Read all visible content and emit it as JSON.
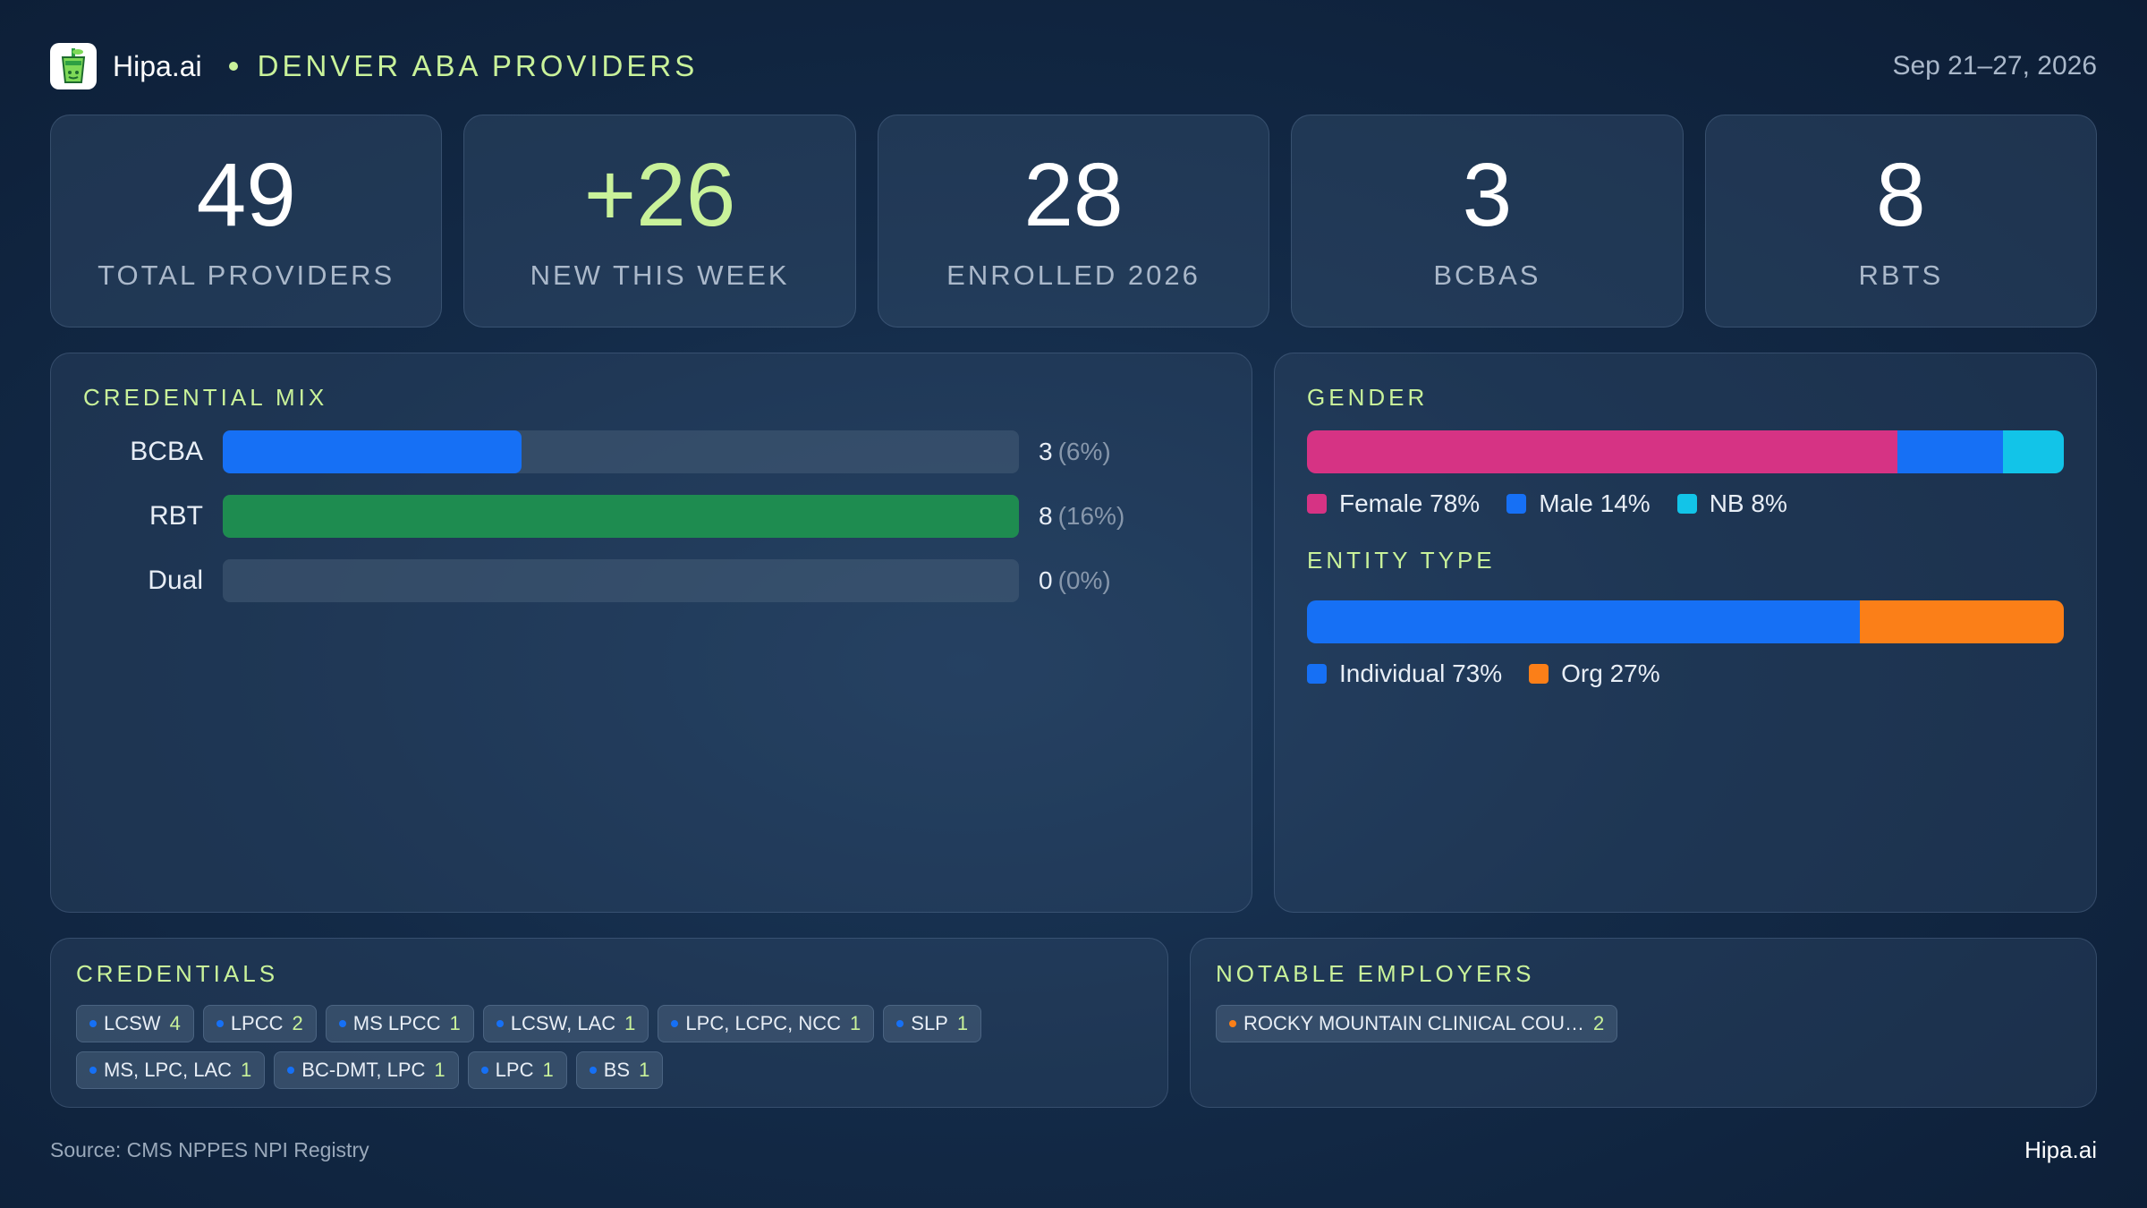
{
  "header": {
    "brand": "Hipa.ai",
    "title": "DENVER ABA PROVIDERS",
    "date_range": "Sep 21–27, 2026"
  },
  "kpis": [
    {
      "value": "49",
      "label": "TOTAL PROVIDERS"
    },
    {
      "value": "+26",
      "label": "NEW THIS WEEK"
    },
    {
      "value": "28",
      "label": "ENROLLED 2026"
    },
    {
      "value": "3",
      "label": "BCBAS"
    },
    {
      "value": "8",
      "label": "RBTS"
    }
  ],
  "credential_mix": {
    "title": "CREDENTIAL MIX"
  },
  "gender": {
    "title": "GENDER",
    "legend": [
      {
        "label": "Female 78%",
        "color": "#d63384"
      },
      {
        "label": "Male 14%",
        "color": "#1670f5"
      },
      {
        "label": "NB 8%",
        "color": "#12c4e8"
      }
    ]
  },
  "entity_type": {
    "title": "ENTITY TYPE",
    "legend": [
      {
        "label": "Individual 73%",
        "color": "#1670f5"
      },
      {
        "label": "Org 27%",
        "color": "#fb7f18"
      }
    ]
  },
  "credentials": {
    "title": "CREDENTIALS",
    "items": [
      {
        "label": "LCSW",
        "count": "4"
      },
      {
        "label": "LPCC",
        "count": "2"
      },
      {
        "label": "MS LPCC",
        "count": "1"
      },
      {
        "label": "LCSW, LAC",
        "count": "1"
      },
      {
        "label": "LPC, LCPC, NCC",
        "count": "1"
      },
      {
        "label": "SLP",
        "count": "1"
      },
      {
        "label": "MS, LPC, LAC",
        "count": "1"
      },
      {
        "label": "BC-DMT, LPC",
        "count": "1"
      },
      {
        "label": "LPC",
        "count": "1"
      },
      {
        "label": "BS",
        "count": "1"
      }
    ],
    "dot_color": "#1670f5"
  },
  "employers": {
    "title": "NOTABLE EMPLOYERS",
    "items": [
      {
        "label": "ROCKY MOUNTAIN CLINICAL COU…",
        "count": "2"
      }
    ],
    "dot_color": "#fb7f18"
  },
  "footer": {
    "source": "Source: CMS NPPES NPI Registry",
    "brand": "Hipa.ai"
  },
  "chart_data": [
    {
      "type": "bar",
      "title": "CREDENTIAL MIX",
      "orientation": "horizontal",
      "categories": [
        "BCBA",
        "RBT",
        "Dual"
      ],
      "values": [
        3,
        8,
        0
      ],
      "value_labels": [
        "3",
        "8",
        "0"
      ],
      "percent_labels": [
        "(6%)",
        "(16%)",
        "(0%)"
      ],
      "colors": [
        "#1670f5",
        "#1e8c50",
        "#1670f5"
      ],
      "xlim": [
        0,
        8
      ]
    },
    {
      "type": "bar",
      "stacked": true,
      "title": "GENDER",
      "series": [
        {
          "name": "Female",
          "values": [
            78
          ],
          "color": "#d63384"
        },
        {
          "name": "Male",
          "values": [
            14
          ],
          "color": "#1670f5"
        },
        {
          "name": "NB",
          "values": [
            8
          ],
          "color": "#12c4e8"
        }
      ]
    },
    {
      "type": "bar",
      "stacked": true,
      "title": "ENTITY TYPE",
      "series": [
        {
          "name": "Individual",
          "values": [
            73
          ],
          "color": "#1670f5"
        },
        {
          "name": "Org",
          "values": [
            27
          ],
          "color": "#fb7f18"
        }
      ]
    }
  ]
}
